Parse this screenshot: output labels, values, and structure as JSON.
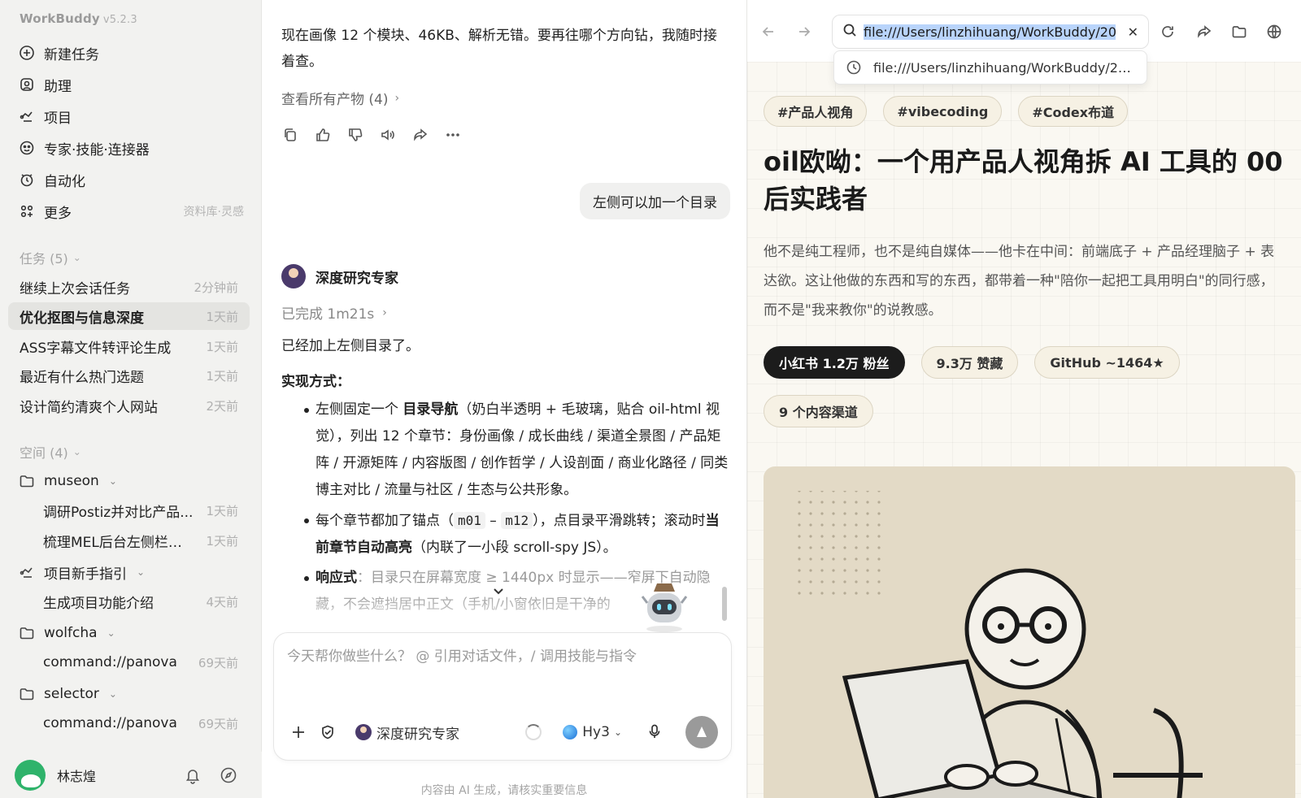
{
  "sidebar": {
    "app_name": "WorkBuddy",
    "version": "v5.2.3",
    "nav": [
      {
        "label": "新建任务",
        "icon": "plus-circle-icon"
      },
      {
        "label": "助理",
        "icon": "assistant-icon"
      },
      {
        "label": "项目",
        "icon": "project-icon"
      },
      {
        "label": "专家·技能·连接器",
        "icon": "expert-icon"
      },
      {
        "label": "自动化",
        "icon": "automation-icon"
      },
      {
        "label": "更多",
        "icon": "more-grid-icon",
        "hint": "资料库·灵感"
      }
    ],
    "tasks_header": "任务 (5)",
    "tasks": [
      {
        "title": "继续上次会话任务",
        "time": "2分钟前"
      },
      {
        "title": "优化抠图与信息深度",
        "time": "1天前",
        "active": true
      },
      {
        "title": "ASS字幕文件转评论生成",
        "time": "1天前"
      },
      {
        "title": "最近有什么热门选题",
        "time": "1天前"
      },
      {
        "title": "设计简约清爽个人网站",
        "time": "2天前"
      }
    ],
    "spaces_header": "空间 (4)",
    "spaces": [
      {
        "name": "museon",
        "icon": "folder-icon",
        "items": [
          {
            "title": "调研Postiz并对比产品...",
            "time": "1天前"
          },
          {
            "title": "梳理MEL后台左侧栏与...",
            "time": "1天前"
          }
        ]
      },
      {
        "name": "项目新手指引",
        "icon": "project-icon",
        "items": [
          {
            "title": "生成项目功能介绍",
            "time": "4天前"
          }
        ]
      },
      {
        "name": "wolfcha",
        "icon": "folder-icon",
        "items": [
          {
            "title": "command://panova",
            "time": "69天前"
          }
        ]
      },
      {
        "name": "selector",
        "icon": "folder-icon",
        "items": [
          {
            "title": "command://panova",
            "time": "69天前"
          }
        ]
      }
    ],
    "user": {
      "name": "林志煌"
    }
  },
  "chat": {
    "intro_text": "现在画像 12 个模块、46KB、解析无错。要再往哪个方向钻，我随时接着查。",
    "artifacts_link": "查看所有产物 (4)",
    "action_icons": [
      "copy-icon",
      "thumbs-up-icon",
      "thumbs-down-icon",
      "speaker-icon",
      "share-icon",
      "more-icon"
    ],
    "user_message": "左侧可以加一个目录",
    "agent_name": "深度研究专家",
    "status": "已完成 1m21s",
    "answer_lead": "已经加上左侧目录了。",
    "answer_heading": "实现方式：",
    "bullets": {
      "b1_pre": "左侧固定一个 ",
      "b1_bold": "目录导航",
      "b1_post": "（奶白半透明 + 毛玻璃，贴合 oil-html 视觉），列出 12 个章节：身份画像 / 成长曲线 / 渠道全景图 / 产品矩阵 / 开源矩阵 / 内容版图 / 创作哲学 / 人设剖面 / 商业化路径 / 同类博主对比 / 流量与社区 / 生态与公共形象。",
      "b2_pre": "每个章节都加了锚点（",
      "b2_code1": "m01",
      "b2_dash": " – ",
      "b2_code2": "m12",
      "b2_mid": "），点目录平滑跳转；滚动时",
      "b2_bold": "当前章节自动高亮",
      "b2_post": "（内联了一小段 scroll-spy JS）。",
      "b3_bold": "响应式",
      "b3_text": "：目录只在屏幕宽度 ≥ 1440px 时显示——窄屏下自动隐藏，不会遮挡居中正文（手机/小窗依旧是干净的"
    },
    "composer_placeholder": "今天帮你做些什么？ @ 引用对话文件，/ 调用技能与指令",
    "composer_agent": "深度研究专家",
    "model": "Hy3",
    "disclaimer": "内容由 AI 生成，请核实重要信息"
  },
  "browser": {
    "url": "file:///Users/linzhihuang/WorkBuddy/20",
    "suggestion": "file:///Users/linzhihuang/WorkBuddy/20...",
    "tags": [
      "#产品人视角",
      "#vibecoding",
      "#Codex布道"
    ],
    "title": "oil欧呦：一个用产品人视角拆 AI 工具的 00 后实践者",
    "description": "他不是纯工程师，也不是纯自媒体——他卡在中间：前端底子 + 产品经理脑子 + 表达欲。这让他做的东西和写的东西，都带着一种\"陪你一起把工具用明白\"的同行感，而不是\"我来教你\"的说教感。",
    "stats": [
      "小红书 1.2万 粉丝",
      "9.3万 赞藏",
      "GitHub ~1464★",
      "9 个内容渠道"
    ]
  },
  "colors": {
    "sidebar_bg": "#f2f2f0",
    "browser_bg": "#faf8f2",
    "tag_bg": "#f6f1e4",
    "dark_pill": "#1c1c1c",
    "url_highlight": "#b9d4fb"
  }
}
